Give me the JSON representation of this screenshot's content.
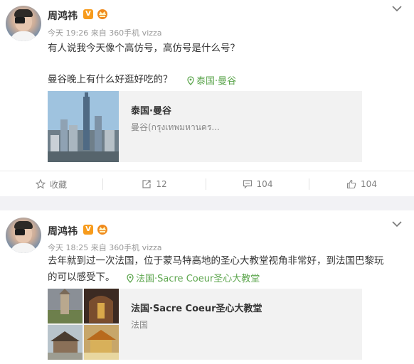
{
  "posts": [
    {
      "user_name": "周鸿祎",
      "verified_badge": "V",
      "meta": "今天 19:26 来自 360手机 vizza",
      "text_line1": "有人说我今天像个高仿号，高仿号是什么号？",
      "text_line2": "曼谷晚上有什么好逛好吃的？",
      "location_tag": "泰国·曼谷",
      "place_card": {
        "title": "泰国·曼谷",
        "subtitle": "曼谷(กรุงเทพมหานคร..."
      },
      "actions": {
        "favorite": "收藏",
        "repost": "12",
        "comment": "104",
        "like": "104"
      }
    },
    {
      "user_name": "周鸿祎",
      "verified_badge": "V",
      "meta": "今天 18:25 来自 360手机 vizza",
      "text_line1": "去年就到过一次法国，位于蒙马特高地的圣心大教堂视角非常好，到法国巴黎玩",
      "text_line2": "的可以感受下。",
      "location_tag": "法国·Sacre Coeur圣心大教堂",
      "place_card": {
        "title": "法国·Sacre Coeur圣心大教堂",
        "subtitle": "法国"
      }
    }
  ],
  "icons": {
    "menu": "chevron-down-icon",
    "location": "location-pin-icon",
    "favorite": "star-icon",
    "repost": "repost-icon",
    "comment": "comment-icon",
    "like": "thumbs-up-icon"
  },
  "colors": {
    "badge": "#f79b1c",
    "location": "#5da64e",
    "meta": "#999999"
  }
}
